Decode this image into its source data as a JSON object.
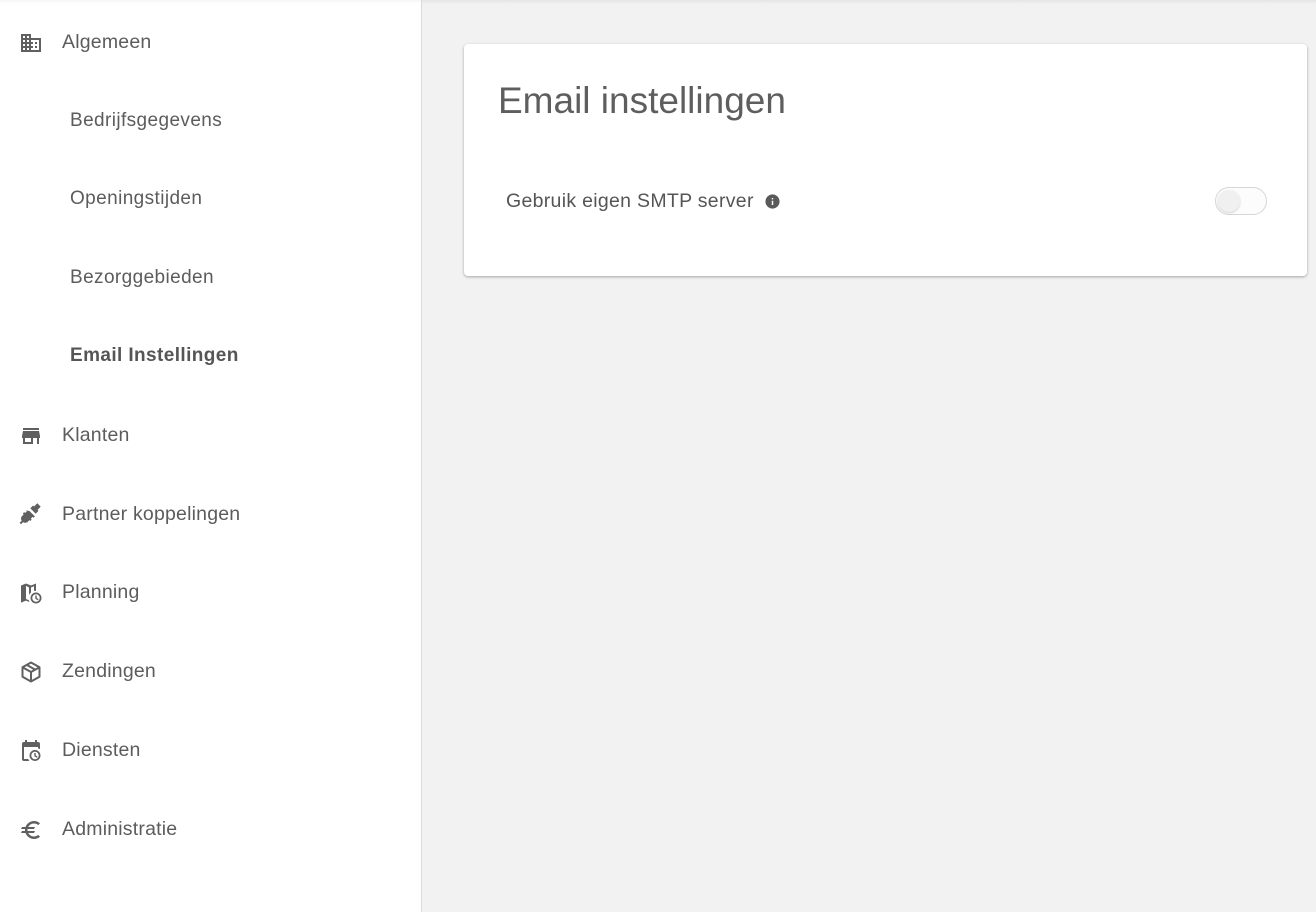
{
  "sidebar": {
    "items": [
      {
        "label": "Algemeen",
        "icon": "building-icon"
      },
      {
        "label": "Bedrijfsgegevens"
      },
      {
        "label": "Openingstijden"
      },
      {
        "label": "Bezorggebieden"
      },
      {
        "label": "Email Instellingen",
        "active": true
      },
      {
        "label": "Klanten",
        "icon": "store-icon"
      },
      {
        "label": "Partner koppelingen",
        "icon": "plug-icon"
      },
      {
        "label": "Planning",
        "icon": "map-clock-icon"
      },
      {
        "label": "Zendingen",
        "icon": "package-icon"
      },
      {
        "label": "Diensten",
        "icon": "calendar-clock-icon"
      },
      {
        "label": "Administratie",
        "icon": "euro-icon"
      }
    ]
  },
  "card": {
    "title": "Email instellingen",
    "setting": {
      "label": "Gebruik eigen SMTP server",
      "enabled": false
    }
  },
  "colors": {
    "background": "#f2f2f2",
    "sidebar": "#ffffff",
    "text": "#5c5c5c"
  }
}
